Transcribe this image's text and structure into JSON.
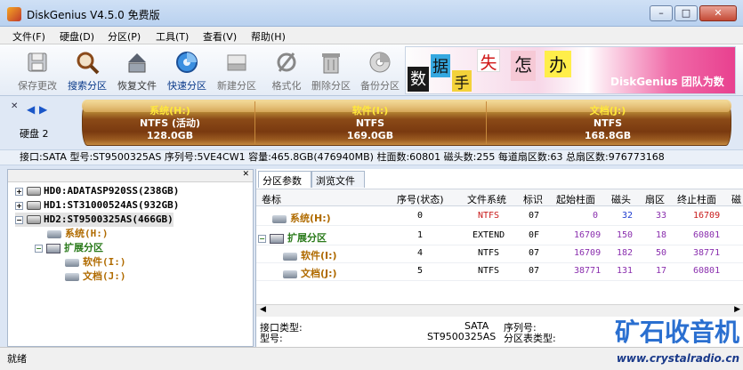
{
  "window": {
    "title": "DiskGenius V4.5.0 免费版",
    "minimize": "–",
    "maximize": "□",
    "close": "✕"
  },
  "menu": [
    "文件(F)",
    "硬盘(D)",
    "分区(P)",
    "工具(T)",
    "查看(V)",
    "帮助(H)"
  ],
  "toolbar": [
    {
      "label": "保存更改",
      "icon": "save-icon",
      "state": "disabled"
    },
    {
      "label": "搜索分区",
      "icon": "search-partition-icon",
      "state": "active"
    },
    {
      "label": "恢复文件",
      "icon": "recover-files-icon",
      "state": "normal"
    },
    {
      "label": "快速分区",
      "icon": "quick-partition-icon",
      "state": "active"
    },
    {
      "label": "新建分区",
      "icon": "new-partition-icon",
      "state": "disabled"
    },
    {
      "label": "格式化",
      "icon": "format-icon",
      "state": "disabled"
    },
    {
      "label": "删除分区",
      "icon": "delete-partition-icon",
      "state": "disabled"
    },
    {
      "label": "备份分区",
      "icon": "backup-partition-icon",
      "state": "disabled"
    }
  ],
  "banner": {
    "chars": [
      "数",
      "据",
      "手",
      "失",
      "怎",
      "办"
    ],
    "text": "DiskGenius 团队为数"
  },
  "disk": {
    "label": "硬盘 2",
    "segments": [
      {
        "name": "系统(H:)",
        "fs": "NTFS (活动)",
        "size": "128.0GB"
      },
      {
        "name": "软件(I:)",
        "fs": "NTFS",
        "size": "169.0GB"
      },
      {
        "name": "文档(J:)",
        "fs": "NTFS",
        "size": "168.8GB"
      }
    ],
    "info": "接口:SATA  型号:ST9500325AS  序列号:5VE4CW1  容量:465.8GB(476940MB)  柱面数:60801  磁头数:255  每道扇区数:63  总扇区数:976773168"
  },
  "tree": [
    {
      "label": "HD0:ADATASP920SS(238GB)",
      "expander": "+",
      "kind": "disk"
    },
    {
      "label": "HD1:ST31000524AS(932GB)",
      "expander": "+",
      "kind": "disk"
    },
    {
      "label": "HD2:ST9500325AS(466GB)",
      "expander": "−",
      "kind": "disk"
    },
    {
      "label": "系统(H:)",
      "kind": "partition",
      "color": "orange"
    },
    {
      "label": "扩展分区",
      "expander": "−",
      "kind": "extended",
      "color": "green"
    },
    {
      "label": "软件(I:)",
      "kind": "partition",
      "color": "orange"
    },
    {
      "label": "文档(J:)",
      "kind": "partition",
      "color": "orange"
    }
  ],
  "tabs": [
    "分区参数",
    "浏览文件"
  ],
  "table": {
    "headers": [
      "卷标",
      "序号(状态)",
      "文件系统",
      "标识",
      "起始柱面",
      "磁头",
      "扇区",
      "终止柱面",
      "磁"
    ],
    "rows": [
      {
        "label": "系统(H:)",
        "seq": "0",
        "fs": "NTFS",
        "id": "07",
        "start_cyl": "0",
        "head": "32",
        "sector": "33",
        "end_cyl": "16709"
      },
      {
        "label": "扩展分区",
        "seq": "1",
        "fs": "EXTEND",
        "id": "0F",
        "start_cyl": "16709",
        "head": "150",
        "sector": "18",
        "end_cyl": "60801"
      },
      {
        "label": "软件(I:)",
        "seq": "4",
        "fs": "NTFS",
        "id": "07",
        "start_cyl": "16709",
        "head": "182",
        "sector": "50",
        "end_cyl": "38771"
      },
      {
        "label": "文档(J:)",
        "seq": "5",
        "fs": "NTFS",
        "id": "07",
        "start_cyl": "38771",
        "head": "131",
        "sector": "17",
        "end_cyl": "60801"
      }
    ]
  },
  "details": {
    "iface_label": "接口类型:",
    "iface_value": "SATA",
    "serial_label": "序列号:",
    "model_label": "型号:",
    "model_value": "ST9500325AS",
    "table_type_label": "分区表类型:"
  },
  "status": "就绪",
  "watermark": {
    "title": "矿石收音机",
    "url": "www.crystalradio.cn"
  }
}
